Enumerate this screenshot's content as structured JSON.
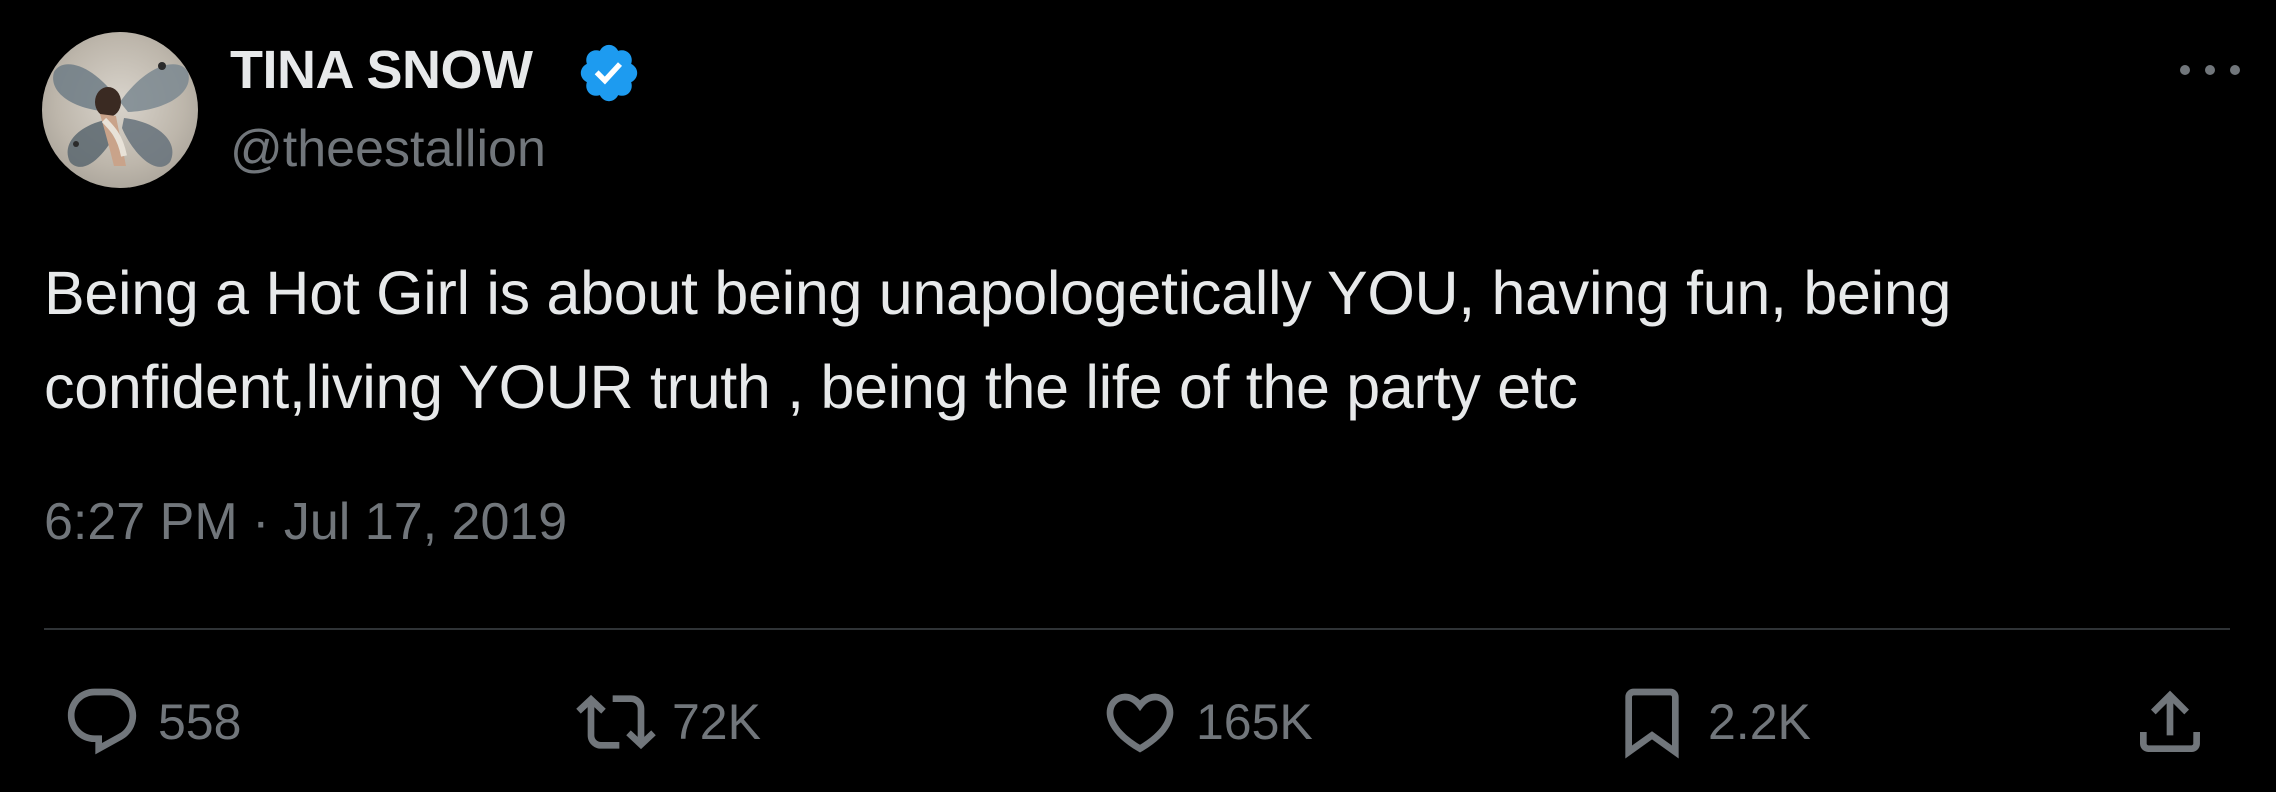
{
  "author": {
    "display_name": "TINA SNOW",
    "handle": "@theestallion",
    "verified": true
  },
  "tweet": {
    "text_lines": [
      "Being a Hot Girl is about being unapologetically YOU, having fun, being",
      "confident,living YOUR truth , being the life of the party etc"
    ],
    "timestamp": "6:27 PM · Jul 17, 2019"
  },
  "actions": {
    "replies": "558",
    "retweets": "72K",
    "likes": "165K",
    "bookmarks": "2.2K"
  },
  "icons": {
    "verified": "verified-badge-icon",
    "more": "more-horizontal-icon",
    "reply": "reply-icon",
    "retweet": "retweet-icon",
    "like": "heart-icon",
    "bookmark": "bookmark-icon",
    "share": "share-icon"
  },
  "colors": {
    "background": "#000000",
    "primary_text": "#e7e9ea",
    "secondary_text": "#71767b",
    "divider": "#2f3336",
    "verified_blue": "#1d9bf0"
  }
}
